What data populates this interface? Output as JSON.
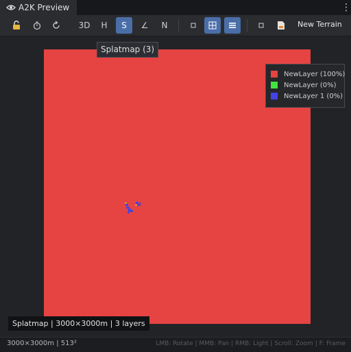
{
  "window": {
    "tab_title": "A2K Preview",
    "tab_icon": "eye-icon",
    "menu_icon": "kebab-menu-icon"
  },
  "toolbar": {
    "lock_icon": "unlock-icon",
    "timer_icon": "stopwatch-icon",
    "refresh_icon": "refresh-icon",
    "mode_3d": "3D",
    "mode_h": "H",
    "mode_s": "S",
    "mode_angle": "∠",
    "mode_n": "N",
    "active_mode": "S",
    "small_square_icon": "square-icon",
    "grid_icon": "grid-icon",
    "layers_icon": "layers-list-icon",
    "small_square_icon_2": "square-icon",
    "terrain_icon": "document-icon",
    "terrain_name": "New Terrain"
  },
  "tooltip": {
    "text": "Splatmap (3)"
  },
  "legend": {
    "items": [
      {
        "label": "NewLayer (100%)",
        "color": "#e64343"
      },
      {
        "label": "NewLayer (0%)",
        "color": "#3ee63e"
      },
      {
        "label": "NewLayer 1 (0%)",
        "color": "#4343e6"
      }
    ]
  },
  "viewport": {
    "splat_color": "#e64343",
    "info_text": "Splatmap | 3000×3000m | 3 layers"
  },
  "statusbar": {
    "left_text": "3000×3000m | 513²",
    "right_text": "LMB: Rotate | MMB: Pan | RMB: Light | Scroll: Zoom | F: Frame"
  }
}
